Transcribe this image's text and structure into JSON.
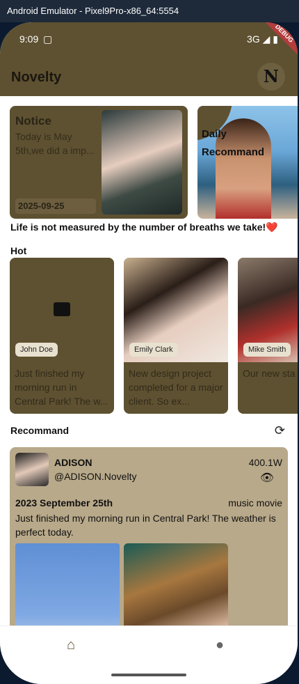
{
  "window": {
    "title": "Android Emulator - Pixel9Pro-x86_64:5554"
  },
  "status": {
    "time": "9:09",
    "network": "3G",
    "debug": "DEBUG"
  },
  "appbar": {
    "title": "Novelty",
    "logo": "N"
  },
  "notice": {
    "title": "Notice",
    "body": "Today is May 5th,we did a imp...",
    "date": "2025-09-25"
  },
  "daily": {
    "title": "Daily Recommand"
  },
  "quote": {
    "text": "Life is not measured by the number of breaths we take!",
    "heart": "❤️"
  },
  "hot": {
    "section_label": "Hot",
    "cards": [
      {
        "author": "John Doe",
        "text": "Just finished my morning run in Central Park! The w..."
      },
      {
        "author": "Emily Clark",
        "text": "New design project completed for a major client. So ex..."
      },
      {
        "author": "Mike Smith",
        "text": "Our new sta office space finally ready"
      }
    ]
  },
  "recommend": {
    "section_label": "Recommand",
    "post": {
      "name": "ADISON",
      "handle": "@ADISON.Novelty",
      "views": "400.1W",
      "date": "2023 September 25th",
      "tags": "music movie",
      "content": "Just finished my morning run in Central Park! The weather is perfect today."
    }
  },
  "icons": [
    "copy-icon",
    "signal-icon",
    "battery-icon",
    "refresh-icon",
    "eye-icon",
    "home-icon",
    "person-icon",
    "broken-image-icon"
  ],
  "colors": {
    "primary": "#5e5131",
    "card": "#b8a98a",
    "debug": "#b33c3c"
  }
}
